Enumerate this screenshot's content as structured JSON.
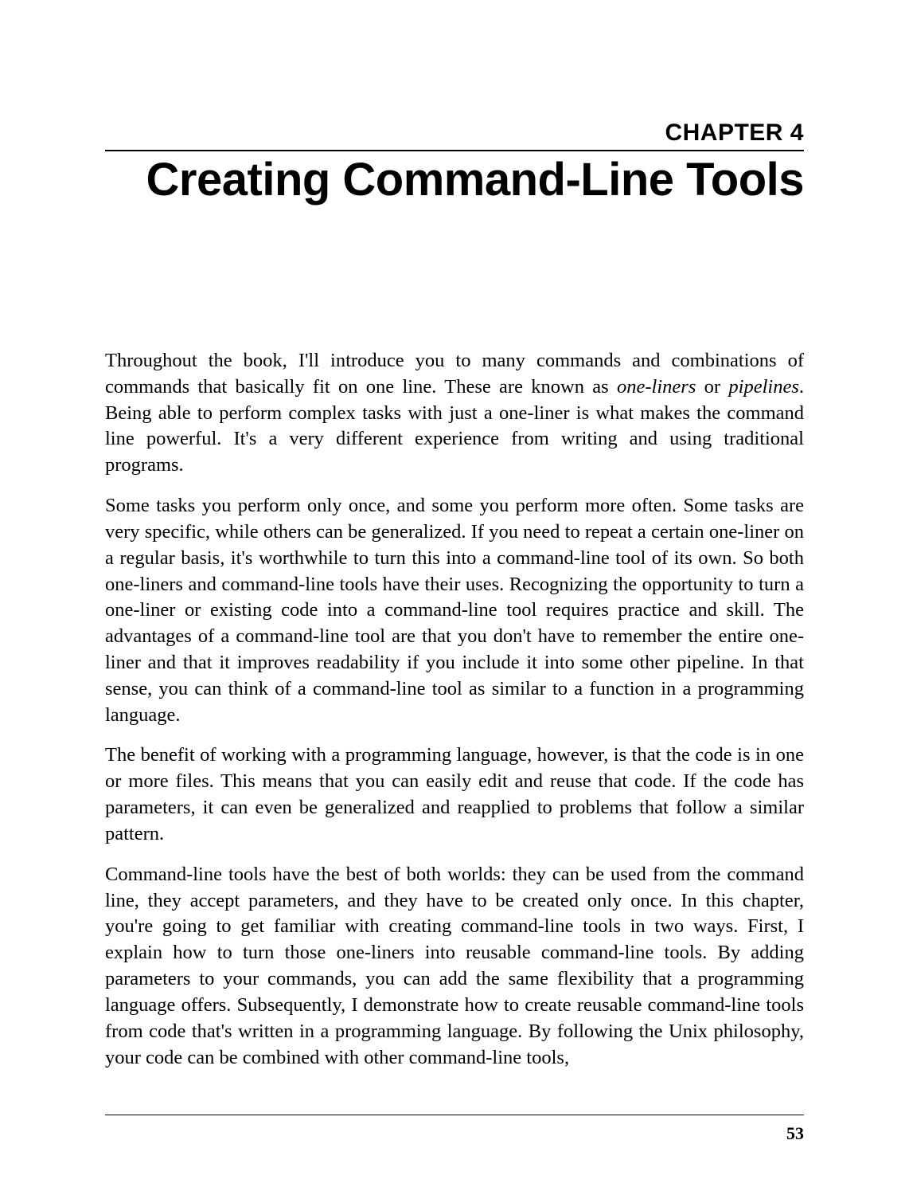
{
  "chapter": {
    "label": "CHAPTER 4",
    "title": "Creating Command-Line Tools"
  },
  "paragraphs": {
    "p1_a": "Throughout the book, I'll introduce you to many commands and combinations of commands that basically fit on one line. These are known as ",
    "p1_em1": "one-liners",
    "p1_b": " or ",
    "p1_em2": "pipelines",
    "p1_c": ". Being able to perform complex tasks with just a one-liner is what makes the com­mand line powerful. It's a very different experience from writing and using traditional programs.",
    "p2": "Some tasks you perform only once, and some you perform more often. Some tasks are very specific, while others can be generalized. If you need to repeat a certain one-liner on a regular basis, it's worthwhile to turn this into a command-line tool of its own. So both one-liners and command-line tools have their uses. Recognizing the opportunity to turn a one-liner or existing code into a command-line tool requires practice and skill. The advantages of a command-line tool are that you don't have to remember the entire one-liner and that it improves readability if you include it into some other pipeline. In that sense, you can think of a command-line tool as similar to a function in a programming language.",
    "p3": "The benefit of working with a programming language, however, is that the code is in one or more files. This means that you can easily edit and reuse that code. If the code has parameters, it can even be generalized and reapplied to problems that follow a similar pattern.",
    "p4": "Command-line tools have the best of both worlds: they can be used from the com­mand line, they accept parameters, and they have to be created only once. In this chapter, you're going to get familiar with creating command-line tools in two ways. First, I explain how to turn those one-liners into reusable command-line tools. By adding parameters to your commands, you can add the same flexibility that a pro­gramming language offers. Subsequently, I demonstrate how to create reusable command-line tools from code that's written in a programming language. By follow­ing the Unix philosophy, your code can be combined with other command-line tools,"
  },
  "page_number": "53"
}
